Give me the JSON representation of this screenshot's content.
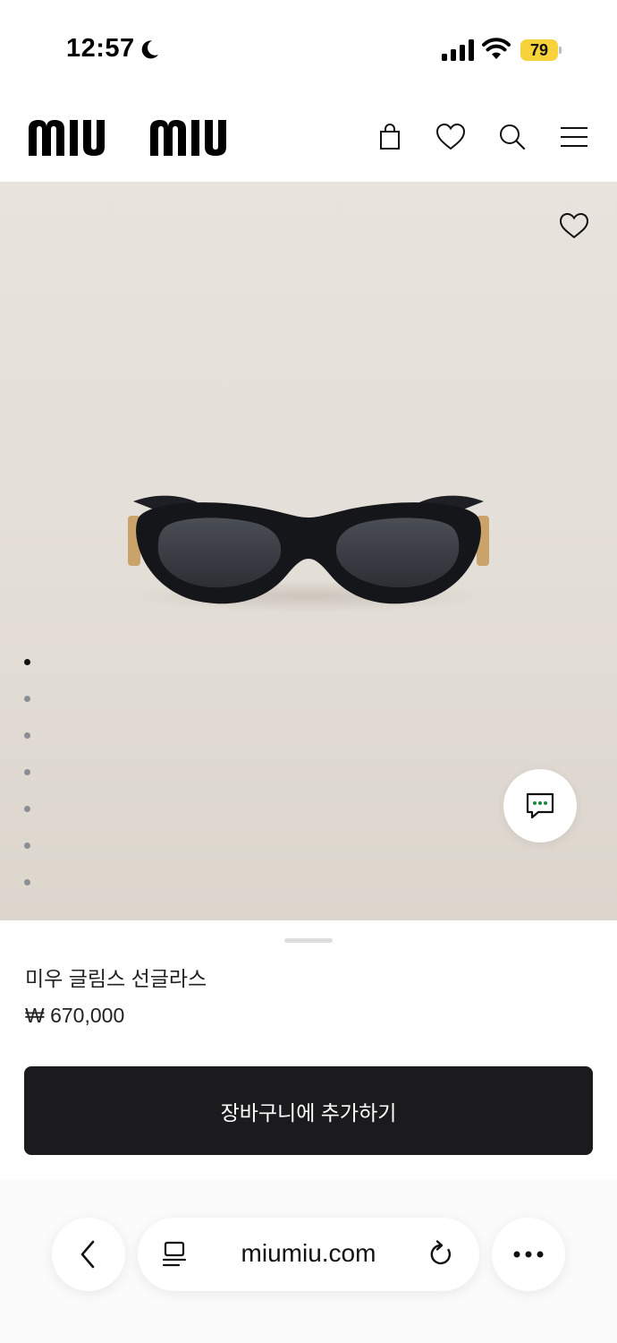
{
  "status_bar": {
    "time": "12:57",
    "battery": "79",
    "battery_color": "#f7d23a"
  },
  "header": {
    "brand": "miu miu",
    "icons": [
      "shopping-bag-icon",
      "heart-icon",
      "search-icon",
      "menu-icon"
    ]
  },
  "gallery": {
    "image_count": 7,
    "active_index": 0,
    "icons": [
      "heart-icon",
      "chat-icon"
    ]
  },
  "product": {
    "name": "미우 글림스 선글라스",
    "price": "₩ 670,000"
  },
  "actions": {
    "add_to_cart": "장바구니에 추가하기"
  },
  "browser": {
    "url": "miumiu.com",
    "icons": [
      "back-icon",
      "tabs-icon",
      "reload-icon",
      "more-icon"
    ]
  }
}
